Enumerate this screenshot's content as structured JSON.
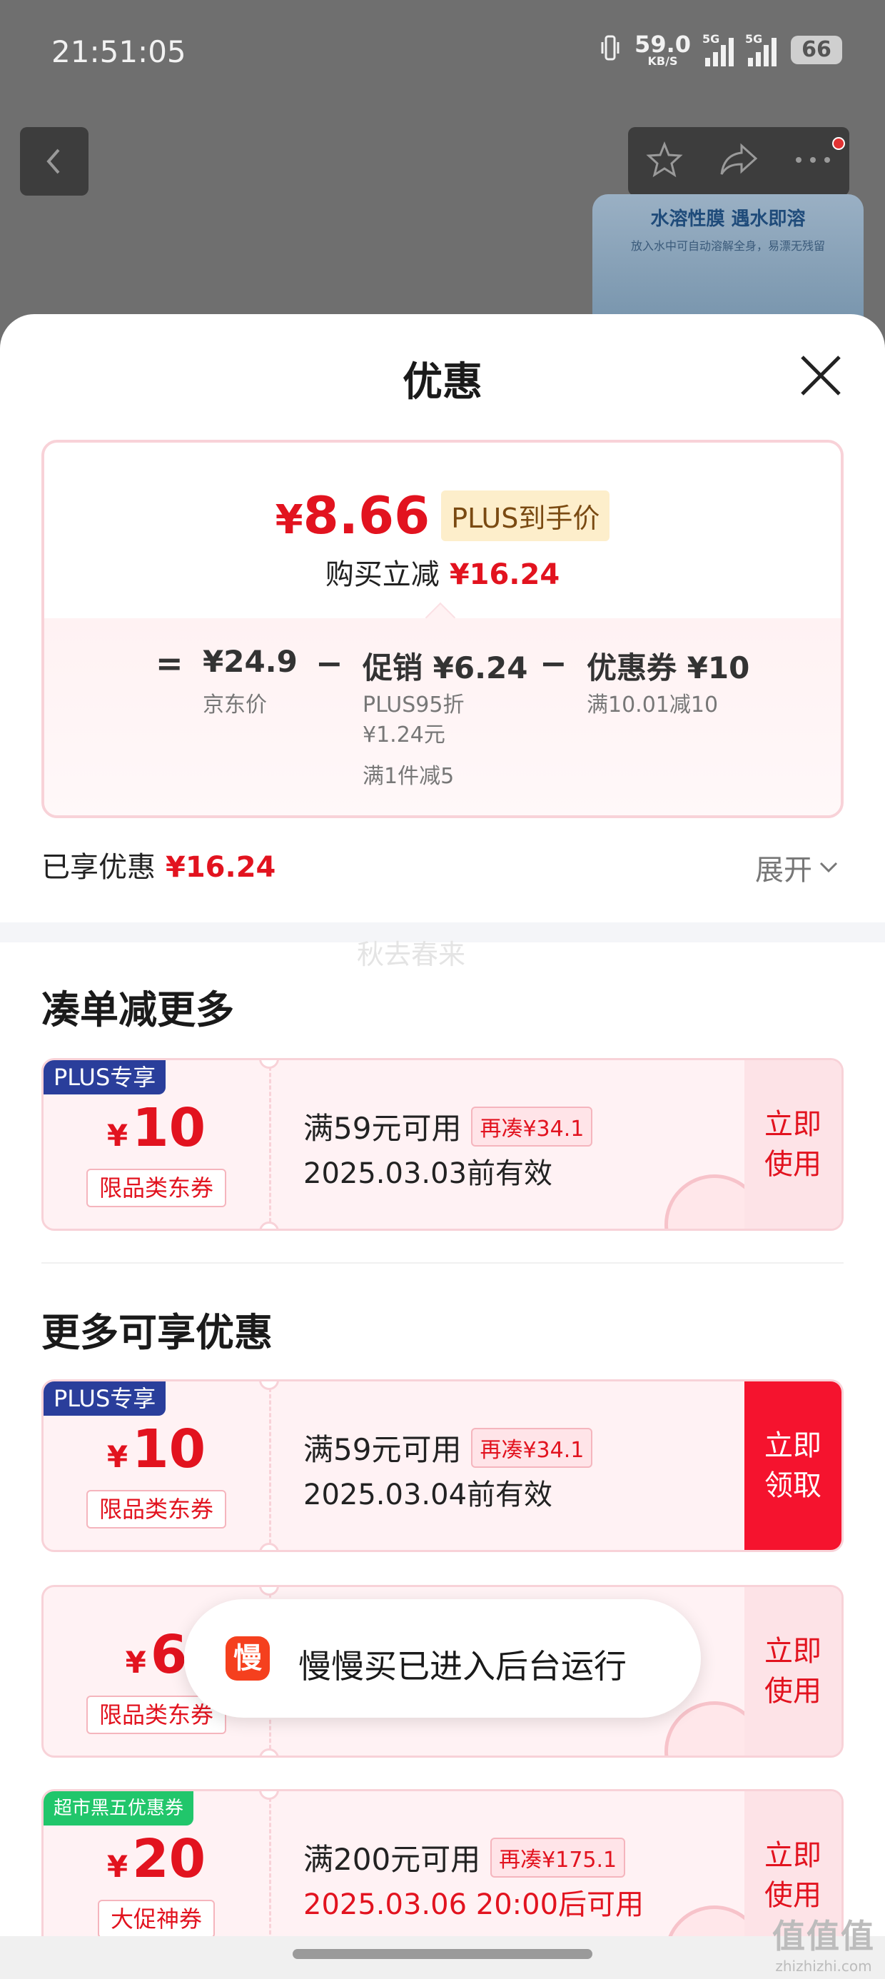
{
  "status_bar": {
    "time": "21:51:05",
    "net_speed": "59.0",
    "net_unit": "KB/S",
    "signal1_tag": "5G",
    "signal2_tag": "5G",
    "battery": "66"
  },
  "background": {
    "banner_title": "水溶性膜 遇水即溶",
    "banner_sub": "放入水中可自动溶解全身，易漂无残留"
  },
  "sheet": {
    "title": "优惠",
    "final_price_symbol": "¥",
    "final_price": "8.66",
    "plus_badge": "PLUS到手价",
    "instant_label": "购买立减",
    "instant_value": "¥16.24",
    "breakdown": {
      "eq": "=",
      "minus": "−",
      "jd_price": "¥24.9",
      "jd_label": "京东价",
      "promo": "促销 ¥6.24",
      "promo_detail_1": "PLUS95折",
      "promo_detail_2": "¥1.24元",
      "promo_detail_3": "满1件减5",
      "coupon": "优惠券 ¥10",
      "coupon_detail": "满10.01减10"
    },
    "enjoyed_label": "已享优惠",
    "enjoyed_value": "¥16.24",
    "expand_label": "展开",
    "watermark": "秋去春来"
  },
  "sections": {
    "more_order_title": "凑单减更多",
    "more_benefits_title": "更多可享优惠"
  },
  "coupons": [
    {
      "tag": "PLUS专享",
      "symbol": "¥",
      "amount": "10",
      "kind": "限品类东券",
      "condition": "满59元可用",
      "extra": "再凑¥34.1",
      "valid": "2025.03.03前有效",
      "action_1": "立即",
      "action_2": "使用"
    },
    {
      "tag": "PLUS专享",
      "symbol": "¥",
      "amount": "10",
      "kind": "限品类东券",
      "condition": "满59元可用",
      "extra": "再凑¥34.1",
      "valid": "2025.03.04前有效",
      "action_1": "立即",
      "action_2": "领取"
    },
    {
      "symbol": "¥",
      "amount": "6",
      "kind": "限品类东券",
      "action_1": "立即",
      "action_2": "使用"
    },
    {
      "tag": "超市黑五优惠券",
      "symbol": "¥",
      "amount": "20",
      "kind": "大促神券",
      "condition": "满200元可用",
      "extra": "再凑¥175.1",
      "valid": "2025.03.06 20:00后可用",
      "action_1": "立即",
      "action_2": "使用"
    }
  ],
  "toast": {
    "icon_char": "慢",
    "text": "慢慢买已进入后台运行"
  },
  "site_mark": {
    "big": "值值值",
    "small": "zhizhizhi.com"
  }
}
